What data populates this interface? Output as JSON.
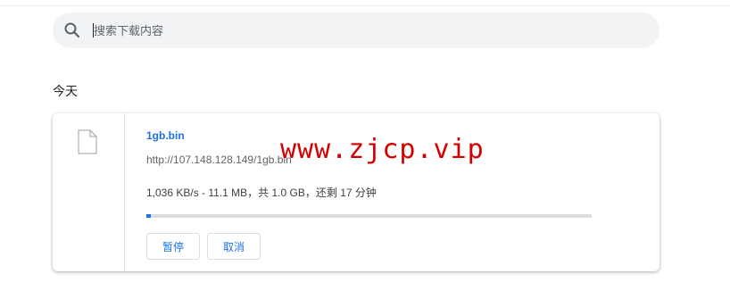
{
  "search": {
    "placeholder": "搜索下载内容",
    "value": ""
  },
  "section": {
    "title": "今天"
  },
  "download": {
    "file_name": "1gb.bin",
    "url": "http://107.148.128.149/1gb.bin",
    "status": "1,036 KB/s - 11.1 MB，共 1.0 GB，还剩 17 分钟",
    "progress_fraction": 0.011,
    "pause_label": "暂停",
    "cancel_label": "取消"
  },
  "watermark": {
    "text": "www.zjcp.vip"
  },
  "colors": {
    "accent": "#1a73e8",
    "watermark": "#d40000",
    "search_bg": "#f1f3f4"
  },
  "icons": {
    "search": "search-icon",
    "file": "file-icon"
  }
}
